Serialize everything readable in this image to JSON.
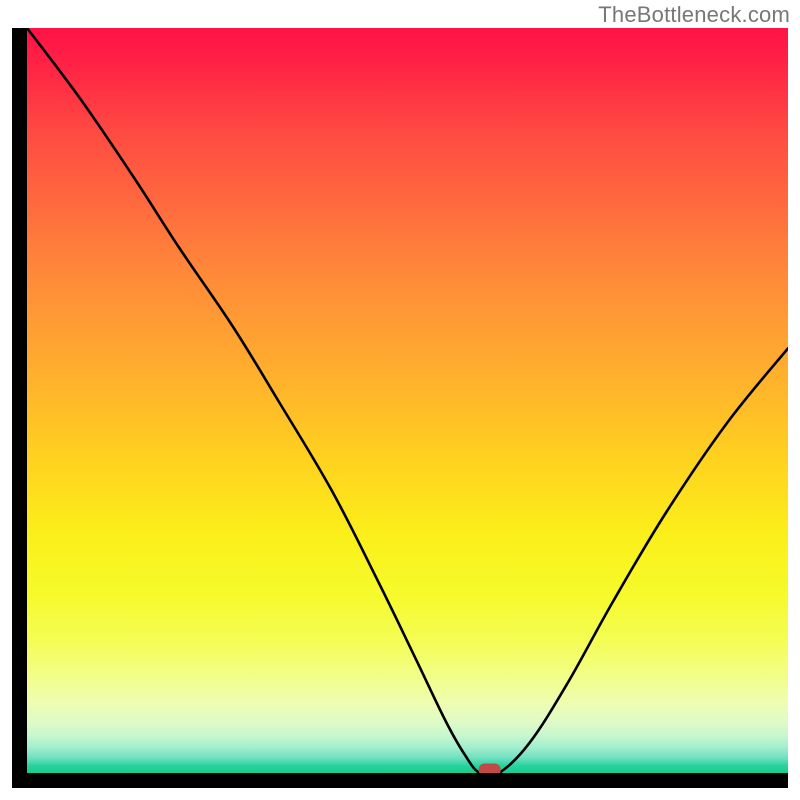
{
  "watermark": "TheBottleneck.com",
  "chart_data": {
    "type": "line",
    "title": "",
    "xlabel": "",
    "ylabel": "",
    "xlim": [
      0,
      100
    ],
    "ylim": [
      0,
      100
    ],
    "series": [
      {
        "name": "curve",
        "x": [
          0,
          7,
          14,
          20,
          27,
          33,
          40,
          46,
          51,
          55,
          57.5,
          59.5,
          62,
          66,
          71,
          77,
          84,
          92,
          100
        ],
        "y": [
          100,
          90.5,
          80,
          70.5,
          60,
          50,
          38,
          26,
          15.5,
          7,
          2.5,
          0,
          0,
          4,
          12,
          23,
          35,
          47,
          57
        ]
      }
    ],
    "marker": {
      "x": 60.8,
      "y": 0.4,
      "color": "#c24a46"
    },
    "gradient_stops": [
      {
        "pos": 0,
        "color": "#ff1247"
      },
      {
        "pos": 0.05,
        "color": "#ff2345"
      },
      {
        "pos": 0.14,
        "color": "#ff4a42"
      },
      {
        "pos": 0.24,
        "color": "#ff6b3e"
      },
      {
        "pos": 0.34,
        "color": "#ff8c38"
      },
      {
        "pos": 0.46,
        "color": "#ffae2e"
      },
      {
        "pos": 0.58,
        "color": "#ffd21f"
      },
      {
        "pos": 0.68,
        "color": "#fbef1a"
      },
      {
        "pos": 0.76,
        "color": "#f6fa2b"
      },
      {
        "pos": 0.825,
        "color": "#f4fd57"
      },
      {
        "pos": 0.87,
        "color": "#f2fe88"
      },
      {
        "pos": 0.905,
        "color": "#eefdb0"
      },
      {
        "pos": 0.93,
        "color": "#e0fbc6"
      },
      {
        "pos": 0.95,
        "color": "#c7f7ce"
      },
      {
        "pos": 0.965,
        "color": "#a3efce"
      },
      {
        "pos": 0.98,
        "color": "#6fe0bf"
      },
      {
        "pos": 0.99,
        "color": "#28d39e"
      },
      {
        "pos": 1.0,
        "color": "#17cd8f"
      }
    ]
  }
}
